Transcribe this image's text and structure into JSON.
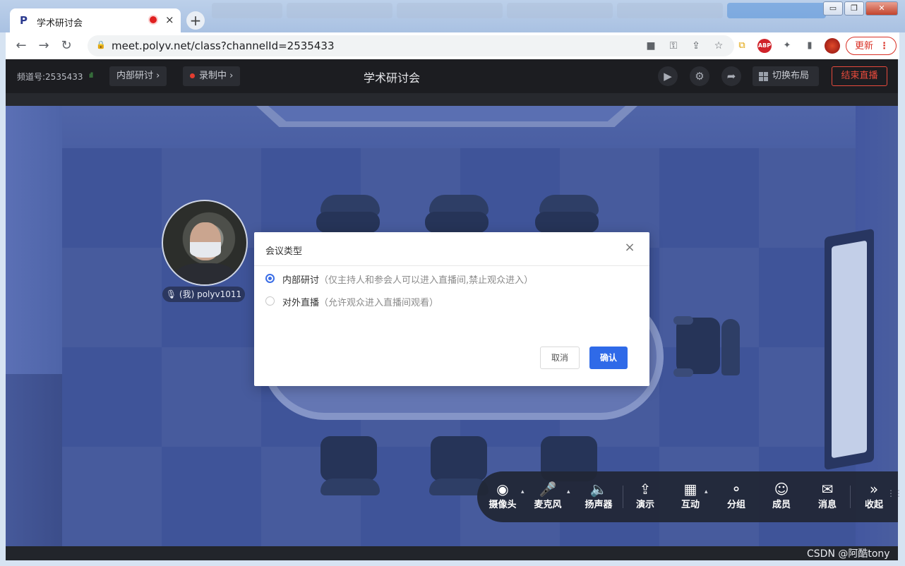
{
  "browser": {
    "tab_title": "学术研讨会",
    "tab_favicon": "P",
    "tab_close": "×",
    "new_tab": "+",
    "url": "meet.polyv.net/class?channelId=2535433",
    "update_label": "更新",
    "update_menu": "⋮",
    "abp_label": "ABP",
    "window_controls": {
      "minimize": "▭",
      "restore": "❐",
      "close": "✕"
    },
    "icons": {
      "back": "←",
      "forward": "→",
      "reload": "↻",
      "lock": "🔒",
      "camera": "■",
      "key": "⚿",
      "share": "⇪",
      "star": "☆",
      "copy": "⧉",
      "puzzle": "✦",
      "sidepanel": "▮"
    }
  },
  "app_header": {
    "channel": "频道号:2535433",
    "signal": "ıll",
    "meeting_type_chip": "内部研讨",
    "recording_chip": "录制中",
    "title": "学术研讨会",
    "layout_button": "切换布局",
    "end_button": "结束直播",
    "chevron": "›",
    "icons": {
      "playback": "▶",
      "settings": "⚙",
      "share": "➦"
    }
  },
  "participant": {
    "label": "(我) polyv1011",
    "mic_icon": "🎙"
  },
  "modal": {
    "title": "会议类型",
    "close": "×",
    "options": [
      {
        "label": "内部研讨",
        "desc": "（仅主持人和参会人可以进入直播间,禁止观众进入）",
        "selected": true
      },
      {
        "label": "对外直播",
        "desc": "（允许观众进入直播间观看）",
        "selected": false
      }
    ],
    "cancel_label": "取消",
    "confirm_label": "确认"
  },
  "bottom_toolbar": {
    "caret": "▴",
    "grip": "⋮⋮",
    "items": [
      {
        "label": "摄像头",
        "icon": "◉"
      },
      {
        "label": "麦克风",
        "icon": "🎤"
      },
      {
        "label": "扬声器",
        "icon": "🔈"
      },
      {
        "label": "演示",
        "icon": "⇪"
      },
      {
        "label": "互动",
        "icon": "▦"
      },
      {
        "label": "分组",
        "icon": "⚬"
      },
      {
        "label": "成员",
        "icon": "☺"
      },
      {
        "label": "消息",
        "icon": "✉"
      },
      {
        "label": "收起",
        "icon": "»"
      }
    ]
  },
  "watermark": "CSDN @阿酷tony",
  "colors": {
    "accent": "#2f6ae8",
    "danger": "#e84a3c",
    "header_bg": "#1c1d21",
    "stage_floor": "#3f5499"
  }
}
